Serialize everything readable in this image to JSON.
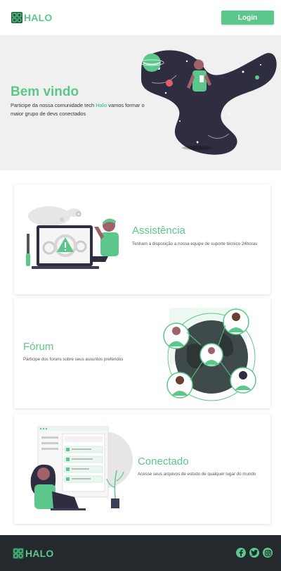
{
  "header": {
    "logo_text": "HALO",
    "login_label": "Login"
  },
  "hero": {
    "title": "Bem vindo",
    "subtitle_before": "Participe da nossa comunidade tech ",
    "subtitle_highlight": "Halo",
    "subtitle_after": " vamos formar o maior grupo de devs conectados"
  },
  "features": [
    {
      "title": "Assistência",
      "description": "Tenham à disposição a nossa equipe de suporte técnico 24horas",
      "illustration": "technician-laptop-warning-illustration"
    },
    {
      "title": "Fórum",
      "description": "Participe dos foruns sobre seus assuntos preferidos",
      "illustration": "community-globe-people-illustration"
    },
    {
      "title": "Conectado",
      "description": "Acesse seus arquivos de estudo de qualquer lugar do mundo",
      "illustration": "woman-laptop-checklist-illustration"
    }
  ],
  "footer": {
    "logo_text": "HALO",
    "social_icons": [
      "facebook-icon",
      "twitter-icon",
      "instagram-icon"
    ]
  },
  "colors": {
    "accent": "#5cc78a",
    "footer_bg": "#23292c",
    "hero_bg": "#f0f0f0"
  }
}
